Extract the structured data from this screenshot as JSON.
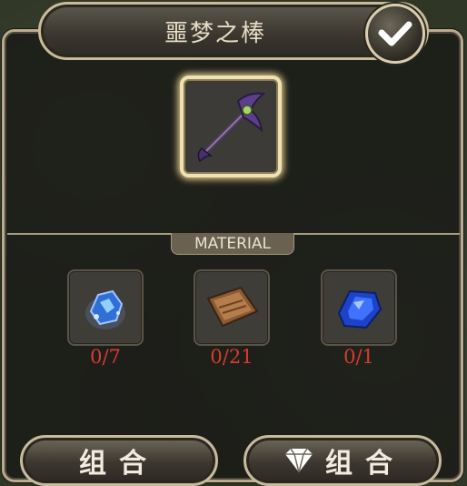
{
  "title": "噩梦之棒",
  "confirm_icon": "checkmark-icon",
  "item": {
    "icon": "nightmare-staff-icon"
  },
  "material_label": "MATERIAL",
  "materials": [
    {
      "icon": "blue-ore-icon",
      "count": "0/7"
    },
    {
      "icon": "leather-scroll-icon",
      "count": "0/21"
    },
    {
      "icon": "blue-gem-icon",
      "count": "0/1"
    }
  ],
  "buttons": {
    "combine": "组合",
    "combine_diamond": "组合",
    "diamond_icon": "diamond-icon"
  },
  "colors": {
    "count_red": "#d93b2f",
    "frame_gold": "#f0e1b2"
  }
}
